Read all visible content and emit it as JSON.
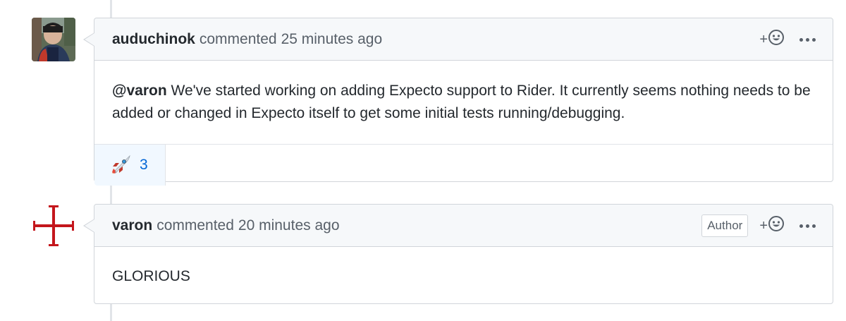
{
  "comments": [
    {
      "author": "auduchinok",
      "action": "commented",
      "time": "25 minutes ago",
      "avatar_icon": "photo-avatar",
      "body_mention": "@varon",
      "body_text": " We've started working on adding Expecto support to Rider. It currently seems nothing needs to be added or changed in Expecto itself to get some initial tests running/debugging.",
      "reactions": [
        {
          "icon": "rocket-emoji",
          "count": "3"
        }
      ],
      "add_reaction_label": "+"
    },
    {
      "author": "varon",
      "action": "commented",
      "time": "20 minutes ago",
      "avatar_icon": "red-cross-avatar",
      "badge": "Author",
      "body_text": "GLORIOUS",
      "add_reaction_label": "+"
    }
  ],
  "colors": {
    "link": "#0366d6",
    "cross_red": "#c4161c",
    "reaction_bg": "#f1f8ff"
  }
}
